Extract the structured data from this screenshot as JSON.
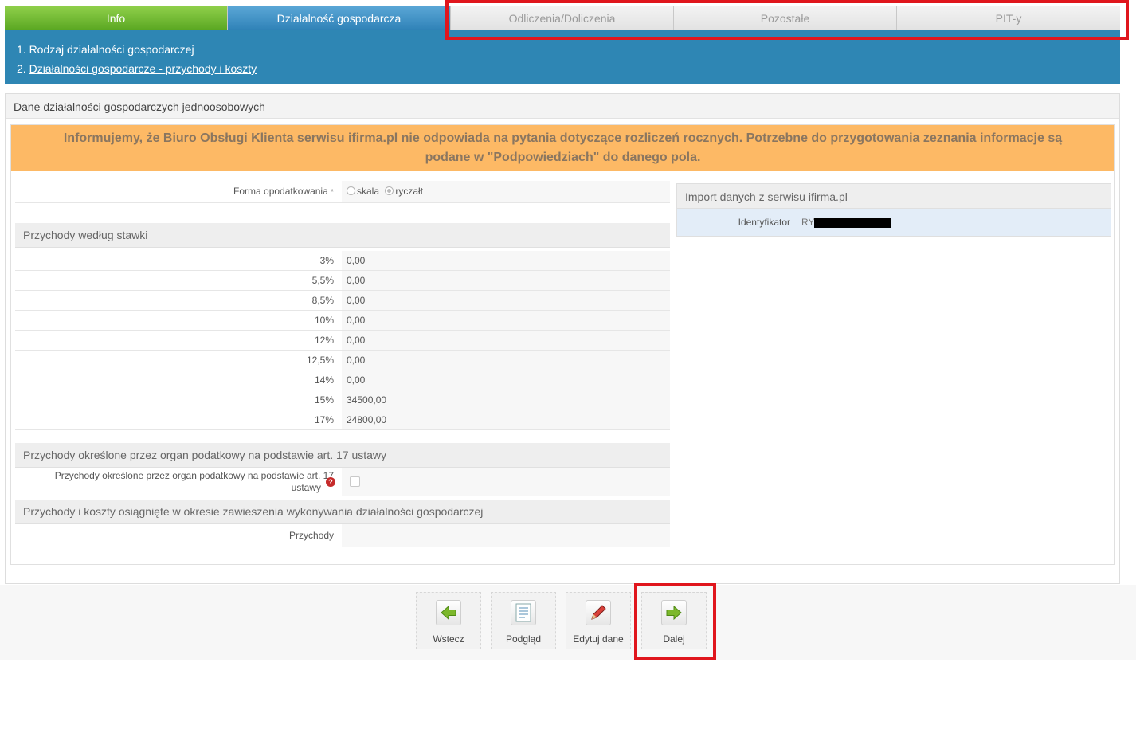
{
  "tabs": [
    {
      "label": "Info"
    },
    {
      "label": "Działalność gospodarcza"
    },
    {
      "label": "Odliczenia/Doliczenia"
    },
    {
      "label": "Pozostałe"
    },
    {
      "label": "PIT-y"
    }
  ],
  "steps": [
    {
      "label": "1. Rodzaj działalności gospodarczej"
    },
    {
      "num": "2.",
      "label": "Działalności gospodarcze - przychody i koszty"
    }
  ],
  "panel": {
    "title": "Dane działalności gospodarczych jednoosobowych"
  },
  "warning": {
    "line1": "Informujemy, że Biuro Obsługi Klienta serwisu ifirma.pl nie odpowiada na pytania dotyczące rozliczeń rocznych. Potrzebne do przygotowania zeznania informacje są",
    "line2": "podane w \"Podpowiedziach\" do danego pola."
  },
  "form": {
    "tax_form_label": "Forma opodatkowania",
    "required_mark": "*",
    "options": [
      "skala",
      "ryczałt"
    ],
    "selected": "ryczałt"
  },
  "rates": {
    "title": "Przychody według stawki",
    "rows": [
      {
        "rate": "3%",
        "value": "0,00"
      },
      {
        "rate": "5,5%",
        "value": "0,00"
      },
      {
        "rate": "8,5%",
        "value": "0,00"
      },
      {
        "rate": "10%",
        "value": "0,00"
      },
      {
        "rate": "12%",
        "value": "0,00"
      },
      {
        "rate": "12,5%",
        "value": "0,00"
      },
      {
        "rate": "14%",
        "value": "0,00"
      },
      {
        "rate": "15%",
        "value": "34500,00"
      },
      {
        "rate": "17%",
        "value": "24800,00"
      }
    ]
  },
  "art17": {
    "title": "Przychody określone przez organ podatkowy na podstawie art. 17 ustawy",
    "field_line1": "Przychody określone przez organ podatkowy na podstawie art. 17",
    "field_line2": "ustawy",
    "help": "?"
  },
  "suspension": {
    "title": "Przychody i koszty osiągnięte w okresie zawieszenia wykonywania działalności gospodarczej",
    "field": "Przychody",
    "value": ""
  },
  "import": {
    "title": "Import danych z serwisu ifirma.pl",
    "id_label": "Identyfikator",
    "id_visible": "RY"
  },
  "buttons": {
    "back": "Wstecz",
    "preview": "Podgląd",
    "edit": "Edytuj dane",
    "next": "Dalej"
  },
  "colors": {
    "tab_active": "#2e86b4",
    "tab_info": "#6bb52d",
    "warning_bg": "#fdb965",
    "highlight": "#e0161d"
  }
}
